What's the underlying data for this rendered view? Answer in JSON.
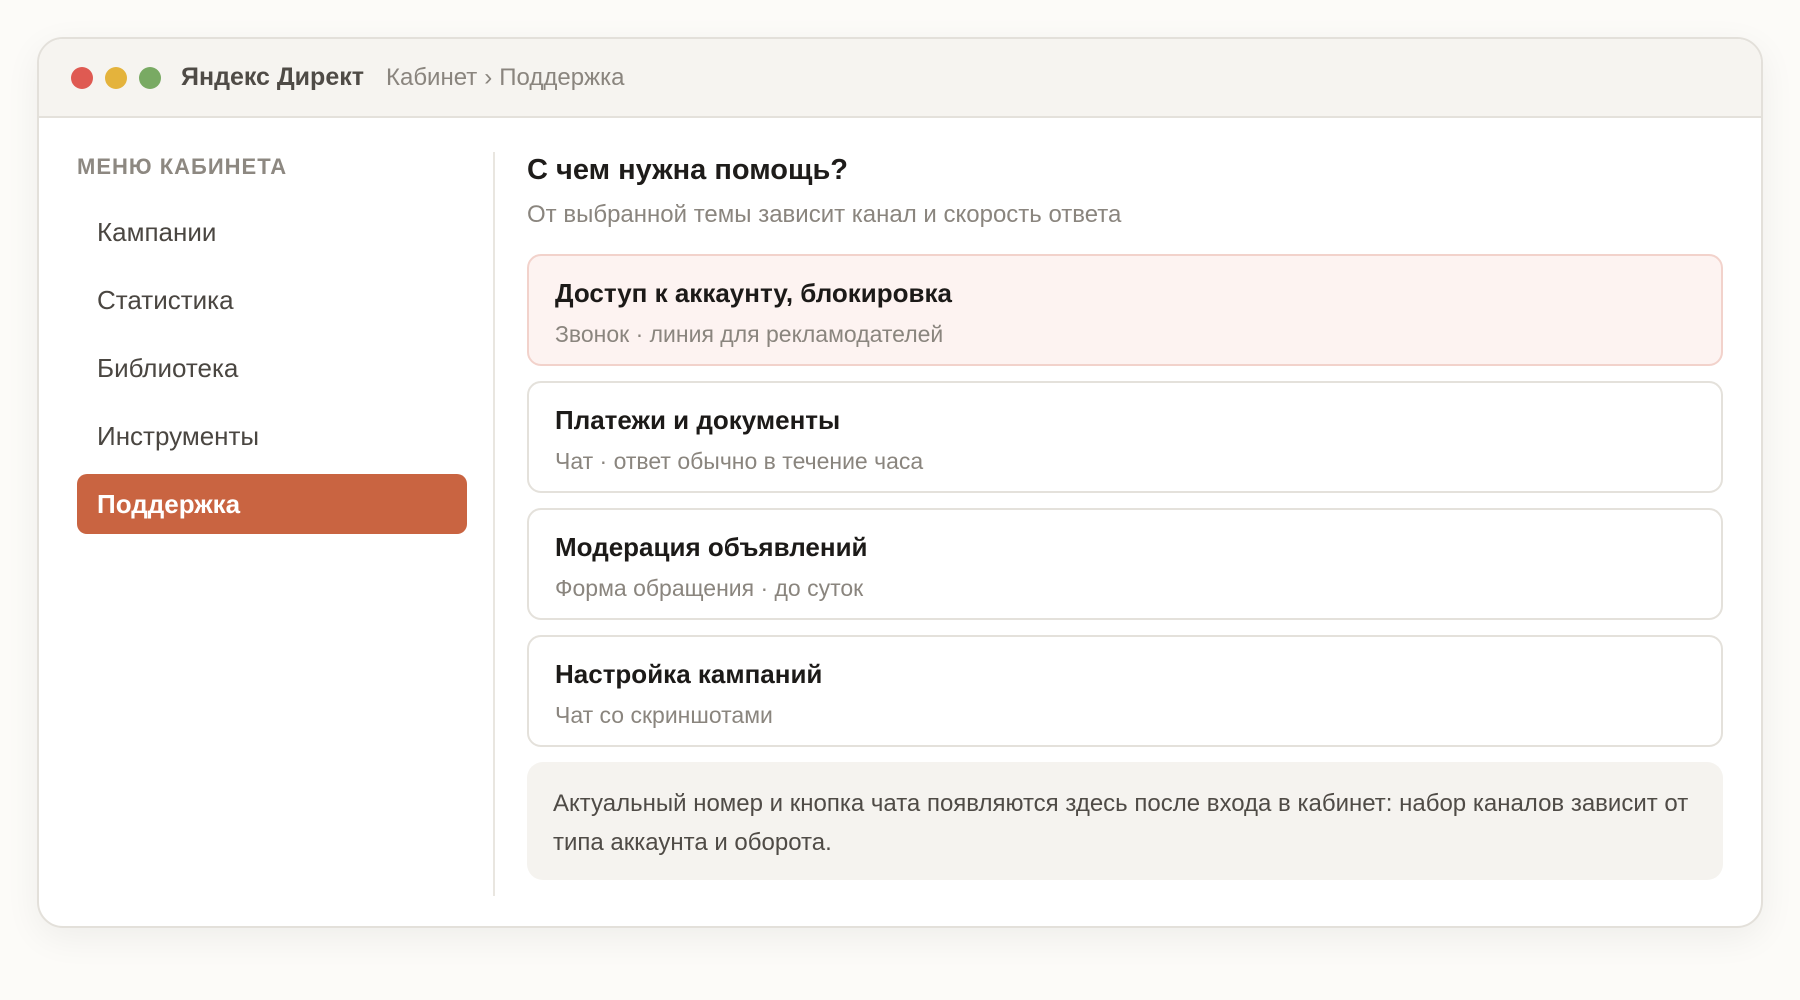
{
  "window": {
    "app_title": "Яндекс Директ",
    "breadcrumb": [
      "Кабинет",
      "Поддержка"
    ],
    "breadcrumb_separator": "›",
    "controls": {
      "close_color": "#df5a52",
      "minimize_color": "#e4b33c",
      "maximize_color": "#79aa63"
    }
  },
  "sidebar": {
    "heading": "МЕНЮ КАБИНЕТА",
    "items": [
      {
        "label": "Кампании",
        "active": false
      },
      {
        "label": "Статистика",
        "active": false
      },
      {
        "label": "Библиотека",
        "active": false
      },
      {
        "label": "Инструменты",
        "active": false
      },
      {
        "label": "Поддержка",
        "active": true
      }
    ],
    "accent_color": "#c96441"
  },
  "main": {
    "title": "С чем нужна помощь?",
    "subtitle": "От выбранной темы зависит канал и скорость ответа",
    "topics": [
      {
        "title": "Доступ к аккаунту, блокировка",
        "desc": "Звонок · линия для рекламодателей",
        "highlighted": true
      },
      {
        "title": "Платежи и документы",
        "desc": "Чат · ответ обычно в течение часа",
        "highlighted": false
      },
      {
        "title": "Модерация объявлений",
        "desc": "Форма обращения · до суток",
        "highlighted": false
      },
      {
        "title": "Настройка кампаний",
        "desc": "Чат со скриншотами",
        "highlighted": false
      }
    ],
    "note": "Актуальный номер и кнопка чата появляются здесь после входа в кабинет: набор каналов зависит от типа аккаунта и оборота."
  }
}
